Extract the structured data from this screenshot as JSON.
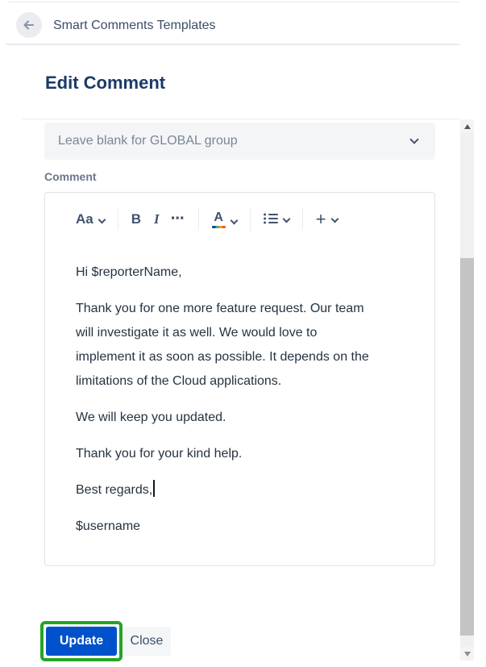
{
  "header": {
    "title": "Smart Comments Templates",
    "back_icon": "arrow-left"
  },
  "page": {
    "heading": "Edit Comment"
  },
  "form": {
    "group_select": {
      "placeholder": "Leave blank for GLOBAL group",
      "chevron_icon": "chevron-down"
    },
    "comment_label": "Comment"
  },
  "toolbar": {
    "text_style_label": "Aa",
    "bold_label": "B",
    "italic_label": "I",
    "more_label": "⋯",
    "color_label": "A",
    "color_bar_colors": [
      "#0747a6",
      "#36b37e",
      "#ff991f",
      "#ff5630"
    ],
    "list_icon": "bullet-list",
    "plus_label": "+"
  },
  "editor": {
    "paragraphs": [
      {
        "lines": [
          "Hi $reporterName,"
        ]
      },
      {
        "lines": [
          "Thank you for one more feature request. Our team",
          "will investigate it as well. We would love to",
          "implement it as soon as possible. It depends on the",
          "limitations of the Cloud applications."
        ]
      },
      {
        "lines": [
          "We will keep you updated."
        ]
      },
      {
        "lines": [
          "Thank you for your kind help."
        ]
      },
      {
        "lines": [
          "Best regards,"
        ],
        "cursor": true
      },
      {
        "lines": [
          "$username"
        ]
      }
    ]
  },
  "actions": {
    "update_label": "Update",
    "close_label": "Close"
  },
  "colors": {
    "accent_blue": "#0052cc",
    "highlight_green": "#27a327",
    "heading_navy": "#1b3a66",
    "toolbar_icon": "#42526e"
  }
}
